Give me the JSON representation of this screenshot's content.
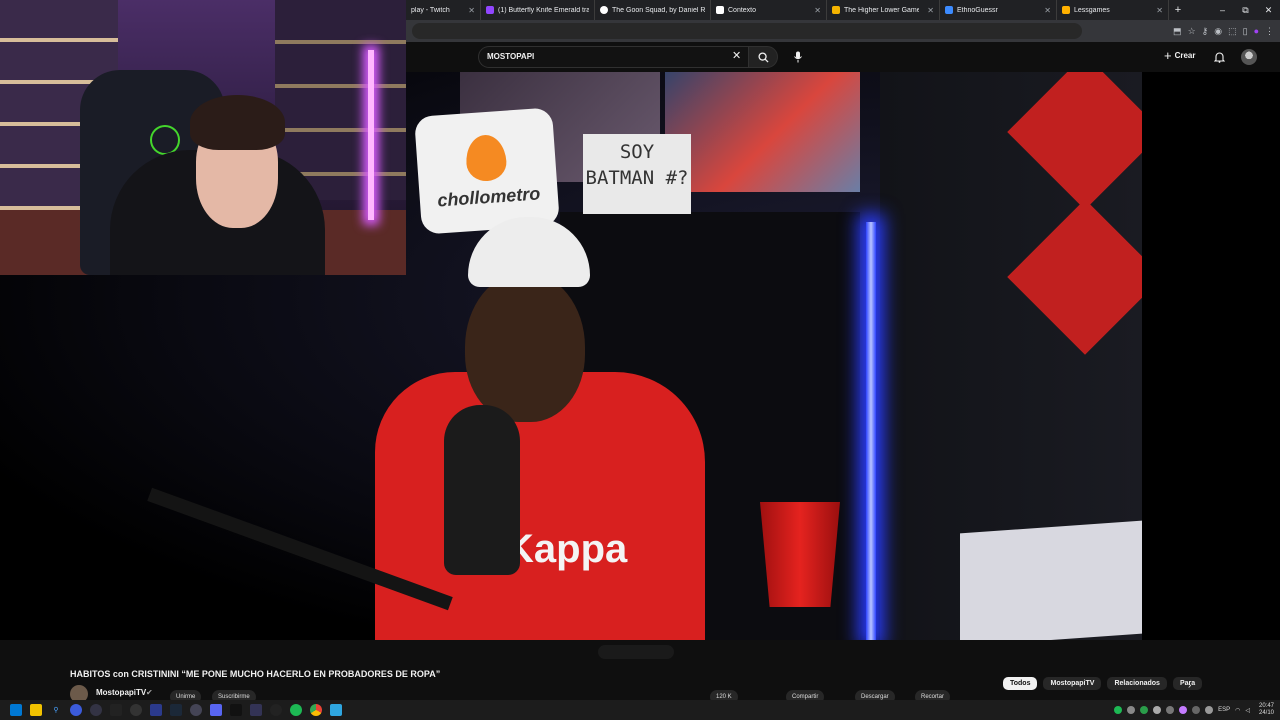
{
  "browser": {
    "tabs": [
      {
        "label": "play - Twitch",
        "color": "#9146ff"
      },
      {
        "label": "(1) Butterfly Knife Emerald tra",
        "color": "#9146ff"
      },
      {
        "label": "The Goon Squad, by Daniel R",
        "color": "#ffffff"
      },
      {
        "label": "Contexto",
        "color": "#ffffff"
      },
      {
        "label": "The Higher Lower Game",
        "color": "#f5b400"
      },
      {
        "label": "EthnoGuessr",
        "color": "#3c8bff"
      },
      {
        "label": "Lessgames",
        "color": "#ffb100"
      }
    ],
    "new_tab": "+",
    "window_controls": {
      "minimize": "–",
      "maximize": "⧉",
      "close": "✕"
    }
  },
  "youtube": {
    "search_value": "MOSTOPAPI",
    "clear_icon": "✕",
    "create_label": "Crear",
    "create_plus": "+"
  },
  "video": {
    "pillow_brand": "chollometro",
    "sign_text": "SOY BATMAN #?",
    "shirt_text": "Kappa",
    "title": "HABITOS con CRISTININI “ME PONE MUCHO HACERLO EN PROBADORES DE ROPA”",
    "channel_name": "MostopapiTV",
    "verified_icon": "✔",
    "join_label": "Unirme",
    "subscribe_label": "Suscribirme",
    "likes_label": "120 K",
    "share_label": "Compartir",
    "save_label": "Descargar",
    "clip_label": "Recortar"
  },
  "related_chips": [
    {
      "label": "Todos",
      "active": true
    },
    {
      "label": "MostopapiTV",
      "active": false
    },
    {
      "label": "Relacionados",
      "active": false
    },
    {
      "label": "Para",
      "active": false
    }
  ],
  "chips_next_icon": "›",
  "taskbar": {
    "lang": "ESP",
    "time": "20:47",
    "date": "24/10"
  },
  "colors": {
    "youtube_bg": "#0f0f0f",
    "chrome_tab_bg": "#202124",
    "accent_purple": "#a142f4",
    "red_shirt": "#d8201f",
    "led_blue": "#2d43ff"
  }
}
